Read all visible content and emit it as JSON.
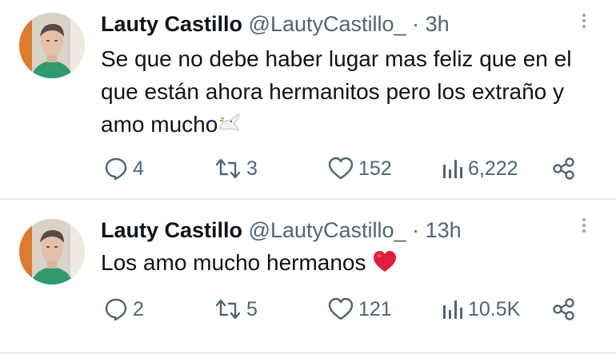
{
  "tweets": [
    {
      "name": "Lauty Castillo",
      "handle": "@LautyCastillo_",
      "separator": "·",
      "time": "3h",
      "text": "Se que no debe haber lugar mas feliz que en el que están ahora hermanitos pero los extraño y amo mucho",
      "emoji": "dove-icon",
      "replies": "4",
      "retweets": "3",
      "likes": "152",
      "views": "6,222"
    },
    {
      "name": "Lauty Castillo",
      "handle": "@LautyCastillo_",
      "separator": "·",
      "time": "13h",
      "text": "Los amo mucho hermanos",
      "emoji": "red-heart-icon",
      "replies": "2",
      "retweets": "5",
      "likes": "121",
      "views": "10.5K"
    }
  ],
  "icons": {
    "reply": "reply-icon",
    "retweet": "retweet-icon",
    "like": "like-icon",
    "views": "views-icon",
    "share": "share-icon",
    "more": "more-icon"
  },
  "colors": {
    "text": "#0f1419",
    "secondary": "#536471",
    "divider": "#e6ecf0",
    "heart_emoji": "#e0203a"
  }
}
